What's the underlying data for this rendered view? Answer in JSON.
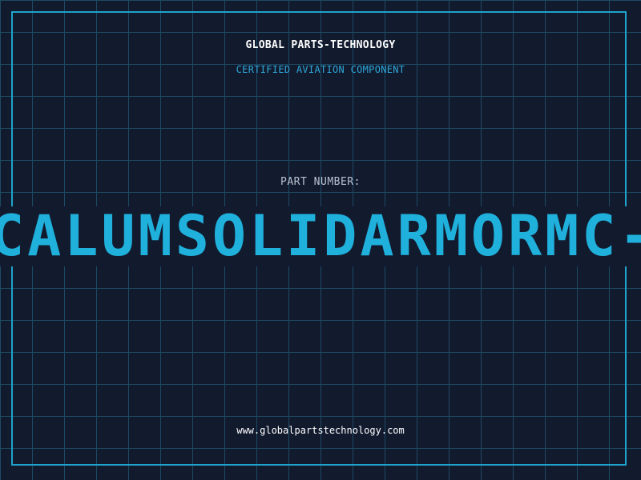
{
  "header": {
    "company": "GLOBAL PARTS-TECHNOLOGY",
    "tagline": "CERTIFIED AVIATION COMPONENT"
  },
  "part": {
    "label": "PART NUMBER:",
    "number": "CALUMSOLIDARMORMC-C"
  },
  "footer": {
    "website": "www.globalpartstechnology.com"
  },
  "colors": {
    "background": "#121a2e",
    "grid": "#1c4a64",
    "accent": "#1fb0dc",
    "frame": "#1fa3cc"
  }
}
